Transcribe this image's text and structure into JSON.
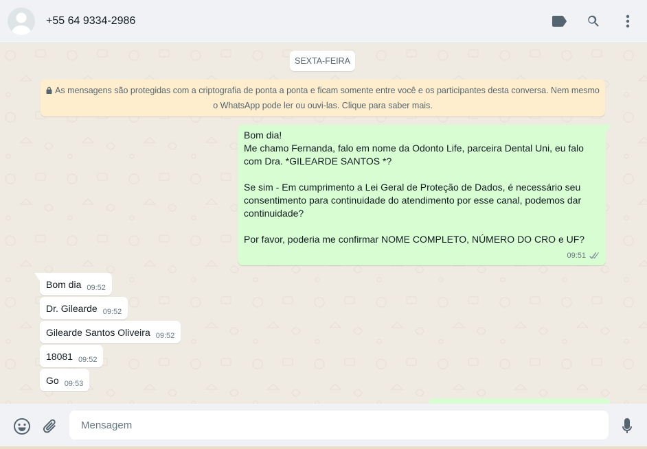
{
  "header": {
    "contact_name": "+55 64 9334-2986",
    "icons": [
      "label-icon",
      "search-icon",
      "menu-icon"
    ]
  },
  "chat": {
    "date_label": "SEXTA-FEIRA",
    "encryption_notice": "As mensagens são protegidas com a criptografia de ponta a ponta e ficam somente entre você e os participantes desta conversa. Nem mesmo o WhatsApp pode ler ou ouvi-las. Clique para saber mais.",
    "outgoing": {
      "lines": [
        "Bom dia!",
        "Me chamo Fernanda, falo em nome da Odonto Life, parceira Dental Uni, eu falo com Dra. *GILEARDE SANTOS *?",
        "",
        "Se sim - Em cumprimento a Lei Geral de Proteção de Dados, é necessário seu consentimento para continuidade do atendimento por esse canal, podemos dar continuidade?",
        "",
        "Por favor, poderia me confirmar NOME COMPLETO, NÚMERO DO CRO e UF?"
      ],
      "time": "09:51",
      "status": "read"
    },
    "incoming": [
      {
        "text": "Bom dia",
        "time": "09:52"
      },
      {
        "text": "Dr. Gilearde",
        "time": "09:52"
      },
      {
        "text": "Gilearde Santos Oliveira",
        "time": "09:52"
      },
      {
        "text": "18081",
        "time": "09:52"
      },
      {
        "text": "Go",
        "time": "09:53"
      }
    ]
  },
  "footer": {
    "input_placeholder": "Mensagem",
    "icons": [
      "emoji-icon",
      "attach-icon",
      "mic-icon"
    ]
  },
  "colors": {
    "outgoing_bubble": "#d9fdd3",
    "incoming_bubble": "#ffffff",
    "encryption_banner": "#ffeecd",
    "chat_background": "#efeae2"
  }
}
